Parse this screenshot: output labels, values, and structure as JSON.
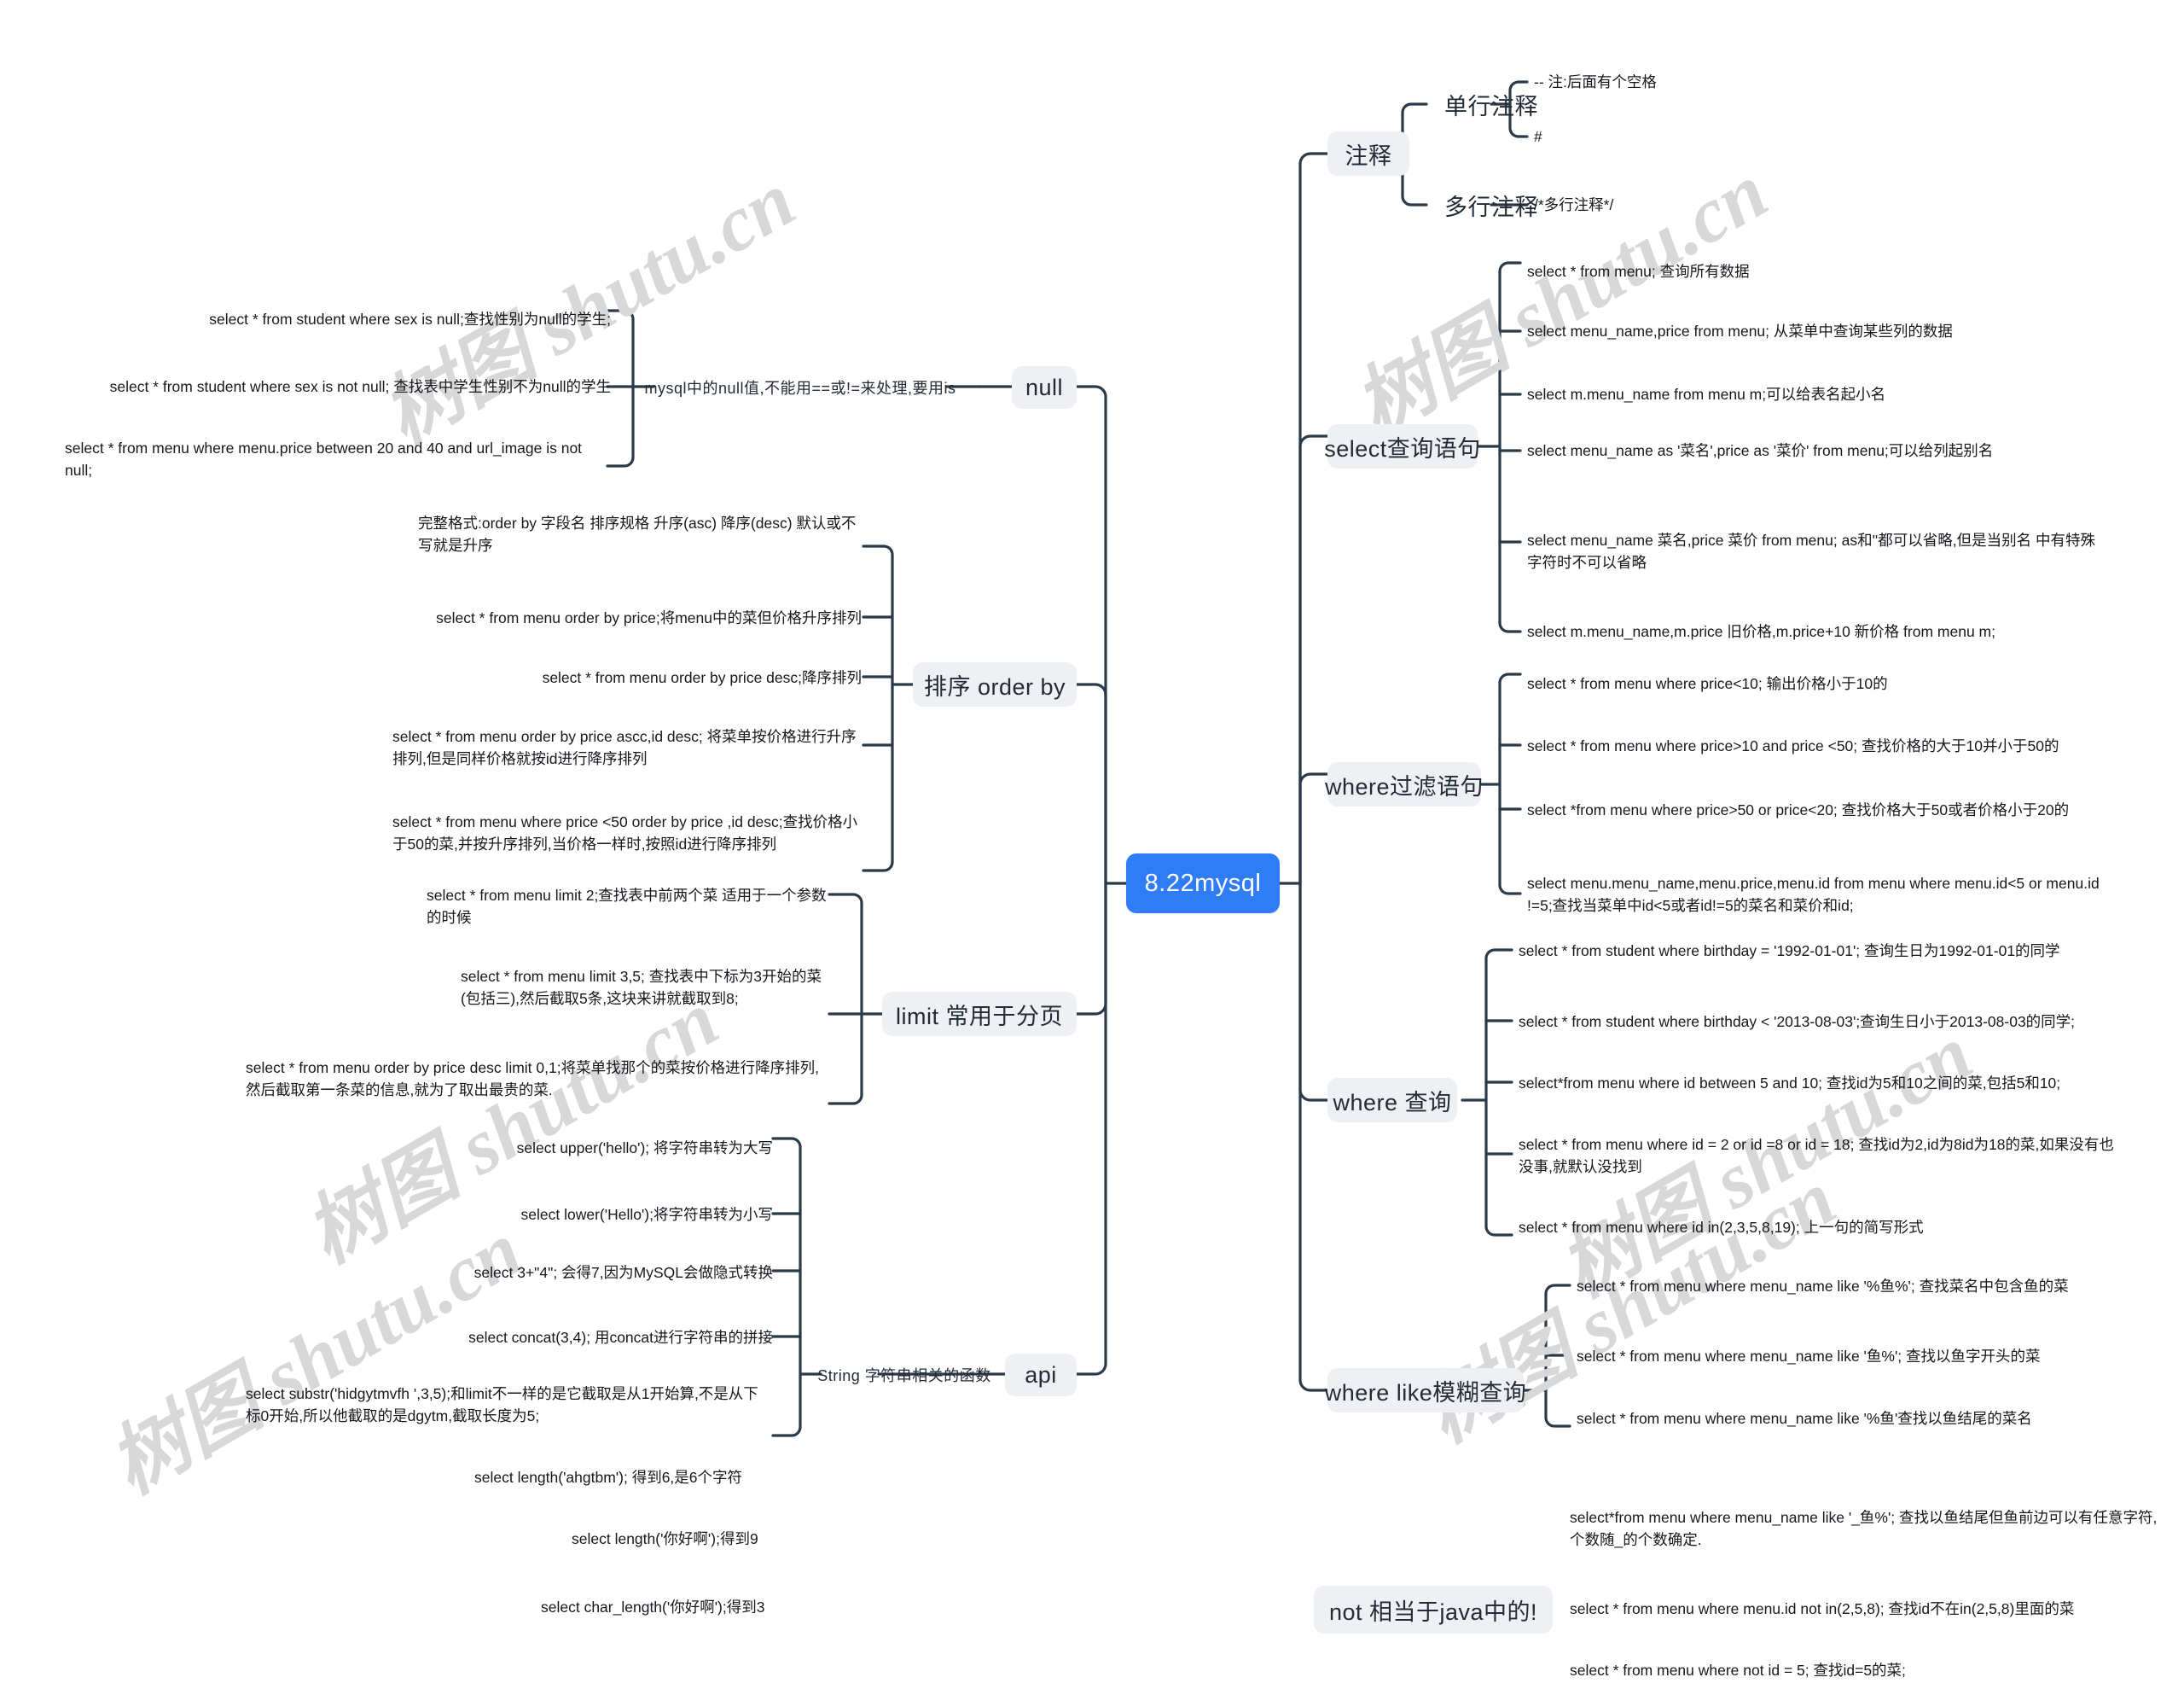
{
  "colors": {
    "root_bg": "#2f7cf6",
    "root_text": "#ffffff",
    "branch_bg": "#eef0f4",
    "branch_text": "#222b36",
    "link": "#2b3a4a",
    "leaf_text": "#16181d",
    "watermark": "#d8d8d8",
    "page_bg": "#ffffff"
  },
  "watermarks": [
    {
      "text": "树图 shutu.cn"
    },
    {
      "text": "树图 shutu.cn"
    },
    {
      "text": "树图 shutu.cn"
    },
    {
      "text": "树图 shutu.cn"
    },
    {
      "text": "树图 shutu.cn"
    },
    {
      "text": "树图 shutu.cn"
    }
  ],
  "root": {
    "label": "8.22mysql"
  },
  "branches": {
    "zhushi": {
      "label": "注释"
    },
    "danhang": {
      "label": "单行注释"
    },
    "duohang": {
      "label": "多行注释"
    },
    "select_query": {
      "label": "select查询语句"
    },
    "where_filter": {
      "label": "where过滤语句"
    },
    "where_query": {
      "label": "where 查询"
    },
    "where_like": {
      "label": "where    like模糊查询"
    },
    "not_node": {
      "label": "not  相当于java中的!"
    },
    "null_node": {
      "label": "null"
    },
    "order_by": {
      "label": "排序  order by"
    },
    "limit_node": {
      "label": "limit     常用于分页"
    },
    "api_node": {
      "label": "api"
    },
    "null_desc": {
      "label": "mysql中的null值,不能用==或!=来处理,要用is"
    },
    "string_api": {
      "label": "String 字符串相关的函数"
    }
  },
  "leaves": {
    "comment_single": [
      {
        "text": "--  注:后面有个空格"
      },
      {
        "text": "#"
      }
    ],
    "comment_multi": [
      {
        "text": "/*多行注释*/"
      }
    ],
    "select_query": [
      {
        "text": "select * from menu;  查询所有数据"
      },
      {
        "text": "select menu_name,price from menu; 从菜单中查询某些列的数据"
      },
      {
        "text": "select  m.menu_name from menu m;可以给表名起小名"
      },
      {
        "text": "select menu_name as '菜名',price as '菜价' from menu;可以给列起别名"
      },
      {
        "text": "select menu_name 菜名,price 菜价 from menu; as和''都可以省略,但是当别名 中有特殊字符时不可以省略"
      },
      {
        "text": "select m.menu_name,m.price 旧价格,m.price+10 新价格 from menu m;"
      }
    ],
    "where_filter": [
      {
        "text": "select * from menu where price<10;  输出价格小于10的"
      },
      {
        "text": "select * from menu where price>10 and price <50;   查找价格的大于10并小于50的"
      },
      {
        "text": "select *from menu where price>50 or price<20; 查找价格大于50或者价格小于20的"
      },
      {
        "text": "select menu.menu_name,menu.price,menu.id from menu where menu.id<5 or menu.id !=5;查找当菜单中id<5或者id!=5的菜名和菜价和id;"
      }
    ],
    "where_query": [
      {
        "text": "select * from student where birthday = '1992-01-01';  查询生日为1992-01-01的同学"
      },
      {
        "text": "select * from student where birthday < '2013-08-03';查询生日小于2013-08-03的同学;"
      },
      {
        "text": "select*from menu where id between 5 and 10; 查找id为5和10之间的菜,包括5和10;"
      },
      {
        "text": "select * from menu where id = 2 or id =8 or id = 18; 查找id为2,id为8id为18的菜,如果没有也没事,就默认没找到"
      },
      {
        "text": "select * from menu where id in(2,3,5,8,19); 上一句的简写形式"
      }
    ],
    "where_like": [
      {
        "text": "select * from menu where menu_name like '%鱼%';  查找菜名中包含鱼的菜"
      },
      {
        "text": "select * from menu where menu_name like '鱼%'; 查找以鱼字开头的菜"
      },
      {
        "text": "select * from menu where menu_name like '%鱼'查找以鱼结尾的菜名"
      }
    ],
    "like_extra": [
      {
        "text": "select*from menu where menu_name like '_鱼%';  查找以鱼结尾但鱼前边可以有任意字符,个数随_的个数确定."
      },
      {
        "text": "select * from menu where menu.id not in(2,5,8); 查找id不在in(2,5,8)里面的菜"
      },
      {
        "text": "select * from menu where not id = 5;  查找id=5的菜;"
      }
    ],
    "null_children": [
      {
        "text": "select * from student where sex is null;查找性别为null的学生;"
      },
      {
        "text": "select * from student where sex is not null;  查找表中学生性别不为null的学生"
      },
      {
        "text": "select * from menu where menu.price between 20 and 40 and url_image is not null;"
      }
    ],
    "order_by": [
      {
        "text": "完整格式:order by 字段名  排序规格      升序(asc) 降序(desc)    默认或不写就是升序"
      },
      {
        "text": "select * from menu order by price;将menu中的菜但价格升序排列"
      },
      {
        "text": "select * from menu order by price desc;降序排列"
      },
      {
        "text": "select * from menu order by price ascc,id desc;  将菜单按价格进行升序排列,但是同样价格就按id进行降序排列"
      },
      {
        "text": "select * from menu where price <50 order by price ,id desc;查找价格小于50的菜,并按升序排列,当价格一样时,按照id进行降序排列"
      }
    ],
    "limit": [
      {
        "text": "select * from menu limit 2;查找表中前两个菜  适用于一个参数的时候"
      },
      {
        "text": "select * from menu limit 3,5;  查找表中下标为3开始的菜(包括三),然后截取5条,这块来讲就截取到8;"
      },
      {
        "text": "select * from menu order by price desc limit 0,1;将菜单找那个的菜按价格进行降序排列,然后截取第一条菜的信息,就为了取出最贵的菜."
      }
    ],
    "api": [
      {
        "text": "select upper('hello'); 将字符串转为大写"
      },
      {
        "text": "select lower('Hello');将字符串转为小写"
      },
      {
        "text": "select 3+\"4\";  会得7,因为MySQL会做隐式转换"
      },
      {
        "text": "select concat(3,4);  用concat进行字符串的拼接"
      },
      {
        "text": "select substr('hidgytmvfh ',3,5);和limit不一样的是它截取是从1开始算,不是从下标0开始,所以他截取的是dgytm,截取长度为5;"
      },
      {
        "text": "select length('ahgtbm'); 得到6,是6个字符"
      },
      {
        "text": "select length('你好啊');得到9"
      },
      {
        "text": "select char_length('你好啊');得到3"
      }
    ]
  }
}
